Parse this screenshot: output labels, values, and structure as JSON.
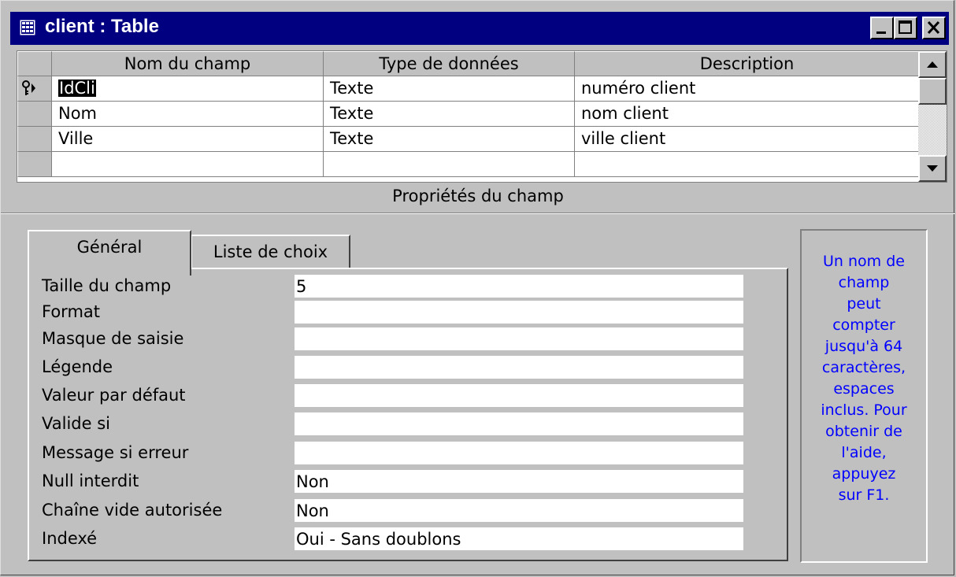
{
  "window": {
    "title": "client : Table",
    "controls": {
      "minimize_icon": "minimize-icon",
      "maximize_icon": "maximize-icon",
      "close_icon": "close-icon"
    }
  },
  "grid": {
    "headers": [
      "Nom du champ",
      "Type de données",
      "Description"
    ],
    "rows": [
      {
        "name": "IdCli",
        "type": "Texte",
        "description": "numéro client",
        "primary_key": true,
        "selected": true
      },
      {
        "name": "Nom",
        "type": "Texte",
        "description": "nom client"
      },
      {
        "name": "Ville",
        "type": "Texte",
        "description": "ville client"
      },
      {
        "name": "",
        "type": "",
        "description": ""
      }
    ]
  },
  "properties": {
    "heading": "Propriétés du champ",
    "tabs": [
      {
        "label": "Général",
        "active": true
      },
      {
        "label": "Liste de choix",
        "active": false
      }
    ],
    "fields": [
      {
        "label": "Taille du champ",
        "value": "5"
      },
      {
        "label": "Format",
        "value": ""
      },
      {
        "label": "Masque de saisie",
        "value": ""
      },
      {
        "label": "Légende",
        "value": ""
      },
      {
        "label": "Valeur par défaut",
        "value": ""
      },
      {
        "label": "Valide si",
        "value": ""
      },
      {
        "label": "Message si erreur",
        "value": ""
      },
      {
        "label": "Null interdit",
        "value": "Non"
      },
      {
        "label": "Chaîne vide autorisée",
        "value": "Non"
      },
      {
        "label": "Indexé",
        "value": "Oui - Sans doublons"
      }
    ],
    "help_lines": [
      "Un nom de",
      "champ",
      "peut",
      "compter",
      "jusqu'à 64",
      "caractères,",
      "espaces",
      "inclus. Pour",
      "obtenir de",
      "l'aide,",
      "appuyez",
      "sur F1."
    ]
  },
  "colors": {
    "title_bg": "#000080",
    "face": "#c0c0c0",
    "help_text": "#0000ff"
  }
}
